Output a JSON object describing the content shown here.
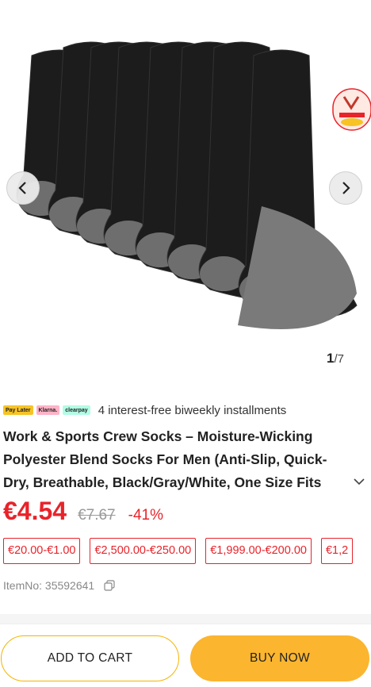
{
  "gallery": {
    "current": "1",
    "total": "/7",
    "prev_icon": "chevron-left-icon",
    "next_icon": "chevron-right-icon",
    "badge_text": "Vogbies"
  },
  "payment": {
    "logos": [
      "Pay Later",
      "Klarna.",
      "clearpay"
    ],
    "text": "4 interest-free biweekly installments"
  },
  "product": {
    "title": "Work & Sports Crew Socks – Moisture-Wicking Polyester Blend Socks For Men (Anti-Slip, Quick-Dry, Breathable, Black/Gray/White, One Size Fits",
    "price": "€4.54",
    "old_price": "€7.67",
    "discount": "-41%",
    "tiers": [
      "€20.00-€1.00",
      "€2,500.00-€250.00",
      "€1,999.00-€200.00",
      "€1,2"
    ],
    "item_no": "ItemNo: 35592641"
  },
  "actions": {
    "add_to_cart": "ADD TO CART",
    "buy_now": "BUY NOW"
  },
  "colors": {
    "accent_red": "#e8232a",
    "buy_yellow": "#fbb52f"
  }
}
